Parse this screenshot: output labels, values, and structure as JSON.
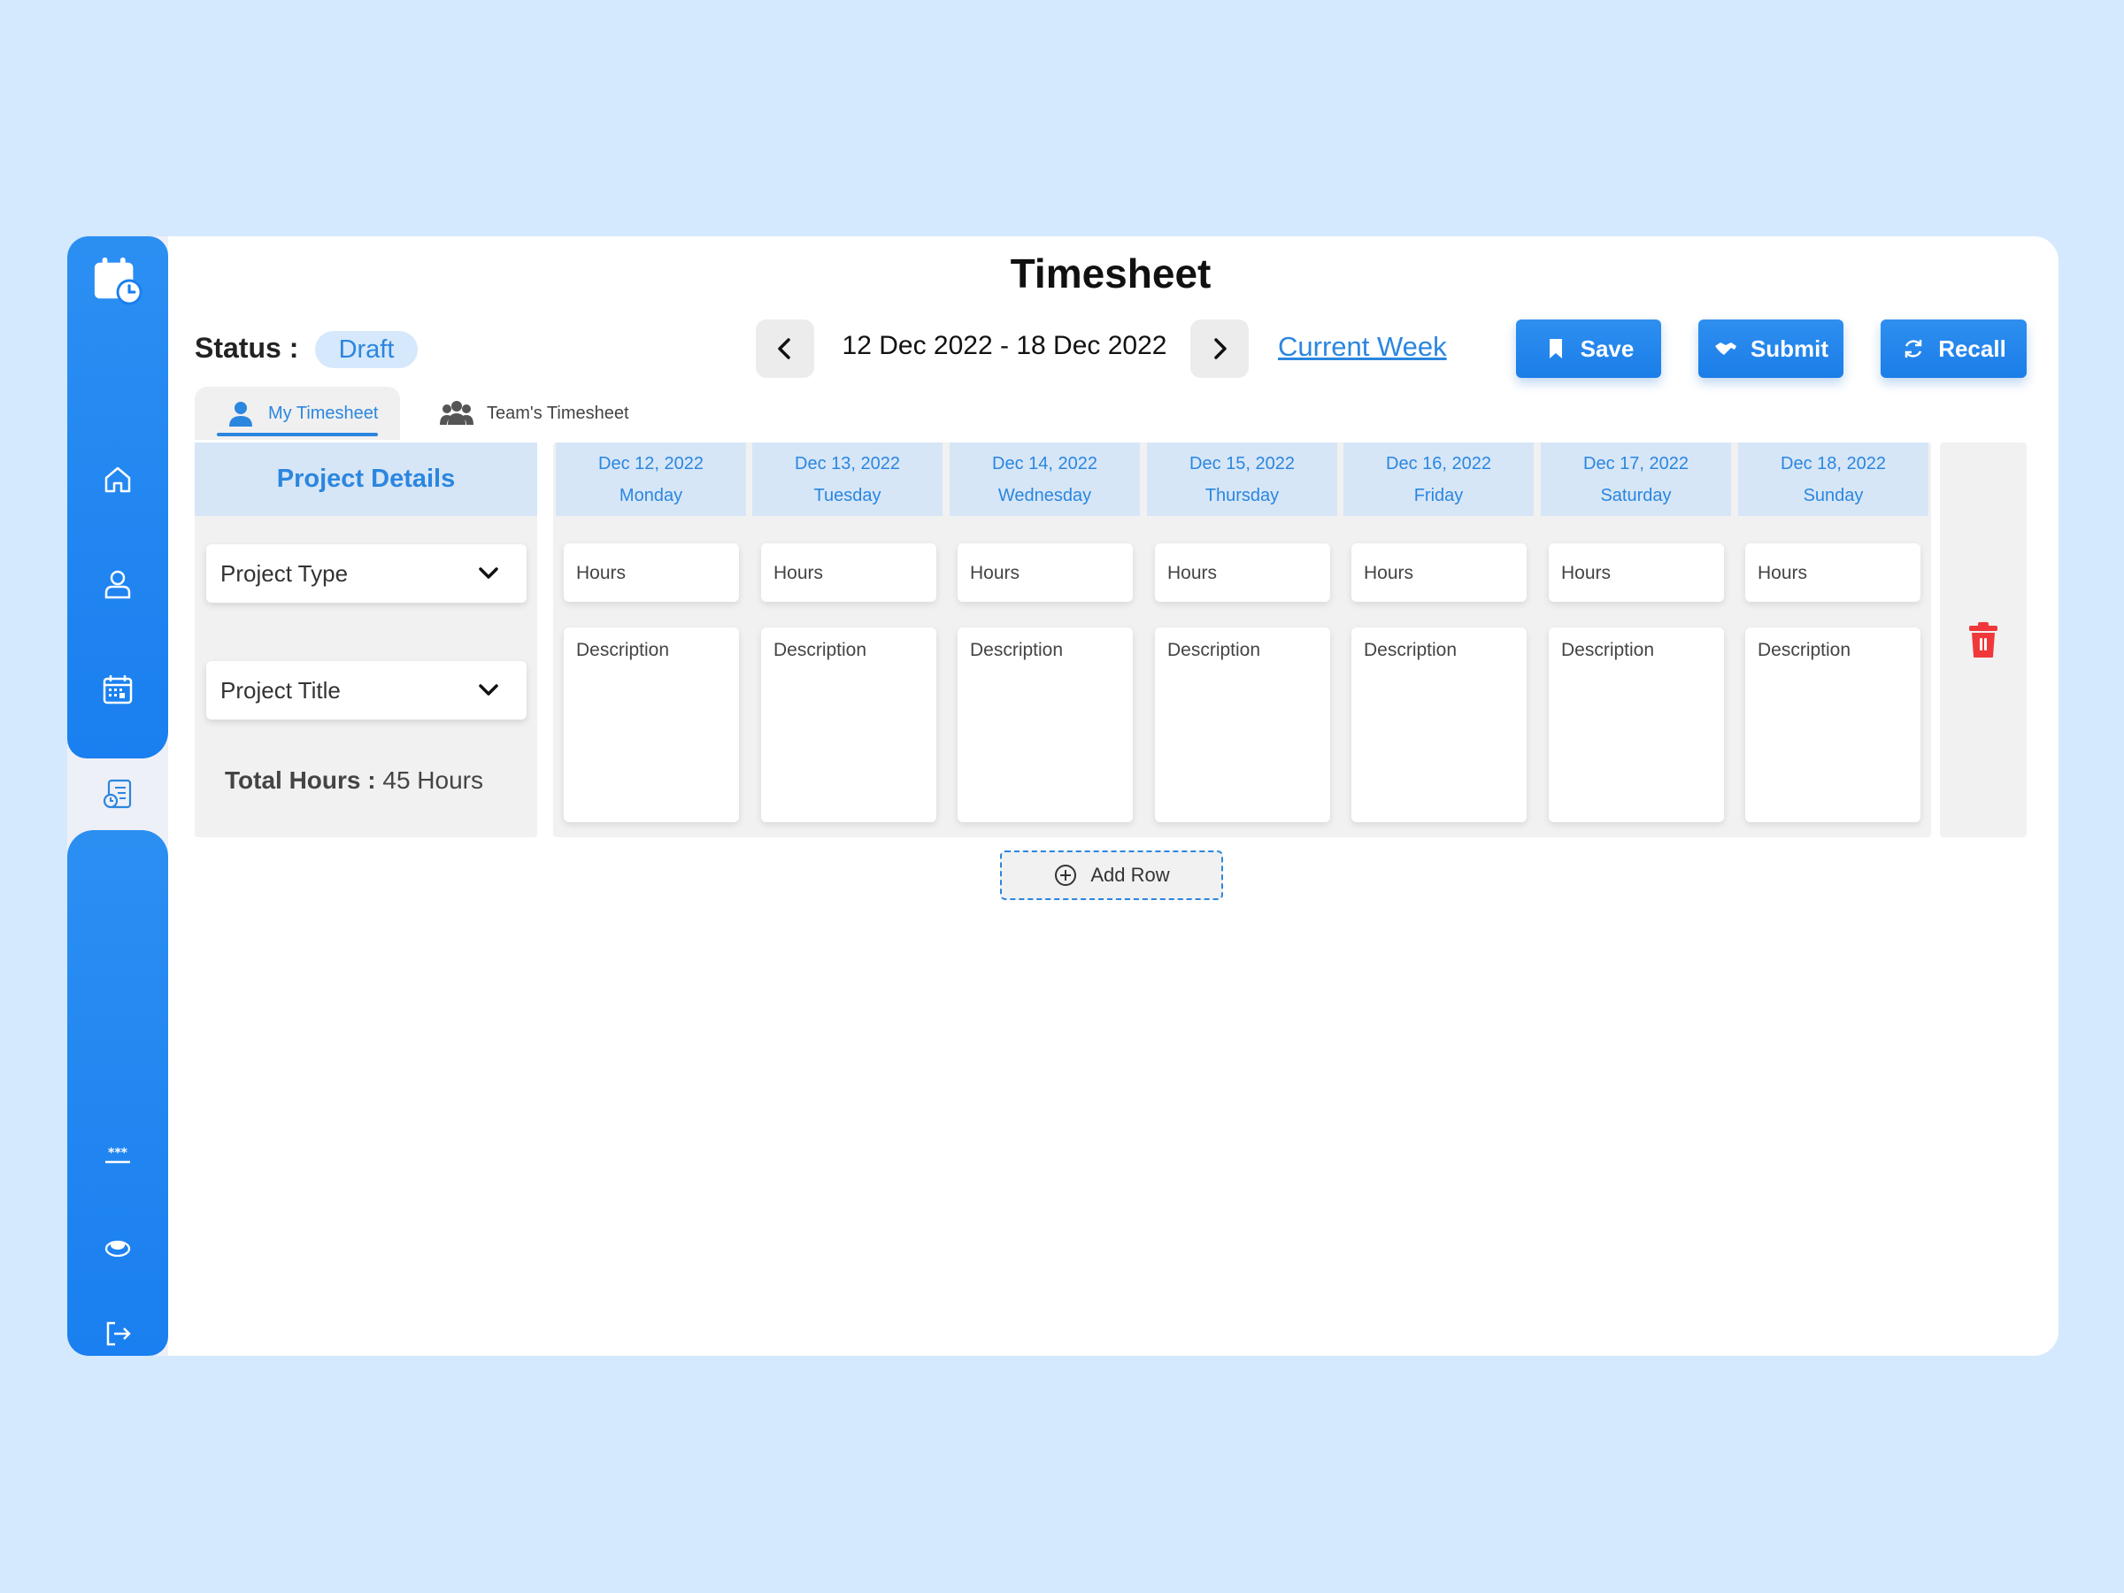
{
  "header": {
    "title": "Timesheet",
    "status_label": "Status :",
    "status_value": "Draft",
    "date_range": "12 Dec 2022 - 18 Dec 2022",
    "current_week": "Current Week"
  },
  "actions": {
    "save": "Save",
    "submit": "Submit",
    "recall": "Recall"
  },
  "tabs": [
    {
      "label": "My Timesheet",
      "active": true
    },
    {
      "label": "Team's Timesheet",
      "active": false
    }
  ],
  "project": {
    "heading": "Project Details",
    "type_placeholder": "Project Type",
    "title_placeholder": "Project Title",
    "total_label": "Total Hours :",
    "total_value": "45 Hours"
  },
  "days": [
    {
      "date": "Dec 12, 2022",
      "weekday": "Monday",
      "hours": "Hours",
      "description": "Description"
    },
    {
      "date": "Dec 13, 2022",
      "weekday": "Tuesday",
      "hours": "Hours",
      "description": "Description"
    },
    {
      "date": "Dec 14, 2022",
      "weekday": "Wednesday",
      "hours": "Hours",
      "description": "Description"
    },
    {
      "date": "Dec 15, 2022",
      "weekday": "Thursday",
      "hours": "Hours",
      "description": "Description"
    },
    {
      "date": "Dec 16, 2022",
      "weekday": "Friday",
      "hours": "Hours",
      "description": "Description"
    },
    {
      "date": "Dec 17, 2022",
      "weekday": "Saturday",
      "hours": "Hours",
      "description": "Description"
    },
    {
      "date": "Dec 18, 2022",
      "weekday": "Sunday",
      "hours": "Hours",
      "description": "Description"
    }
  ],
  "add_row": "Add Row",
  "sidebar": {
    "icons": [
      "calendar-clock-logo",
      "home-icon",
      "user-icon",
      "calendar-icon",
      "timesheet-icon",
      "password-icon",
      "support-icon",
      "logout-icon"
    ]
  },
  "colors": {
    "accent": "#2b86df",
    "sidebar": "#1f86f0",
    "background": "#d4e9fd",
    "danger": "#f0383a"
  }
}
